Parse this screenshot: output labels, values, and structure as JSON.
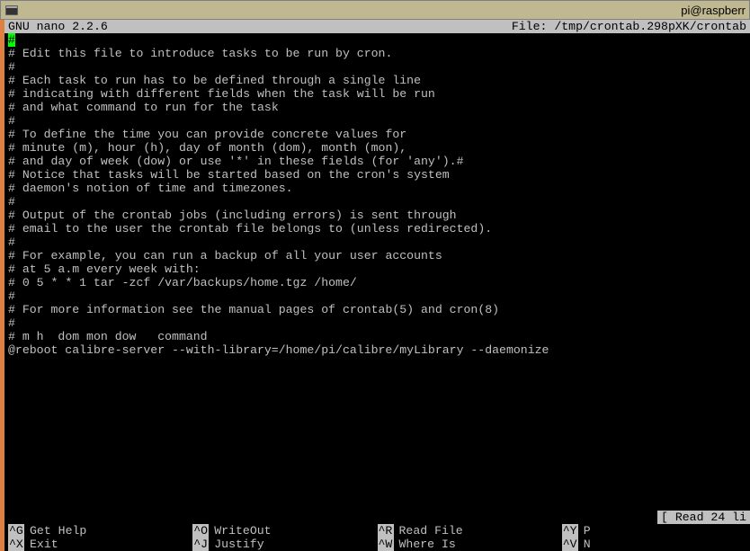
{
  "titlebar": {
    "right": "pi@raspberr"
  },
  "header": {
    "app": "  GNU nano 2.2.6",
    "file": "File: /tmp/crontab.298pXK/crontab"
  },
  "lines": [
    "",
    " Edit this file to introduce tasks to be run by cron.",
    " ",
    " Each task to run has to be defined through a single line",
    " indicating with different fields when the task will be run",
    " and what command to run for the task",
    " ",
    " To define the time you can provide concrete values for",
    " minute (m), hour (h), day of month (dom), month (mon),",
    " and day of week (dow) or use '*' in these fields (for 'any').#",
    " Notice that tasks will be started based on the cron's system",
    " daemon's notion of time and timezones.",
    " ",
    " Output of the crontab jobs (including errors) is sent through",
    " email to the user the crontab file belongs to (unless redirected).",
    " ",
    " For example, you can run a backup of all your user accounts",
    " at 5 a.m every week with:",
    " 0 5 * * 1 tar -zcf /var/backups/home.tgz /home/",
    " ",
    " For more information see the manual pages of crontab(5) and cron(8)",
    " ",
    " m h  dom mon dow   command"
  ],
  "firstchar": "#",
  "comment_prefix": "#",
  "command_line": "@reboot calibre-server --with-library=/home/pi/calibre/myLibrary --daemonize",
  "status": "[ Read 24 li",
  "shortcuts": {
    "r1c1": {
      "key": "^G",
      "label": "Get Help"
    },
    "r1c2": {
      "key": "^O",
      "label": "WriteOut"
    },
    "r1c3": {
      "key": "^R",
      "label": "Read File"
    },
    "r1c4": {
      "key": "^Y",
      "label": "P"
    },
    "r2c1": {
      "key": "^X",
      "label": "Exit"
    },
    "r2c2": {
      "key": "^J",
      "label": "Justify"
    },
    "r2c3": {
      "key": "^W",
      "label": "Where Is"
    },
    "r2c4": {
      "key": "^V",
      "label": "N"
    }
  }
}
